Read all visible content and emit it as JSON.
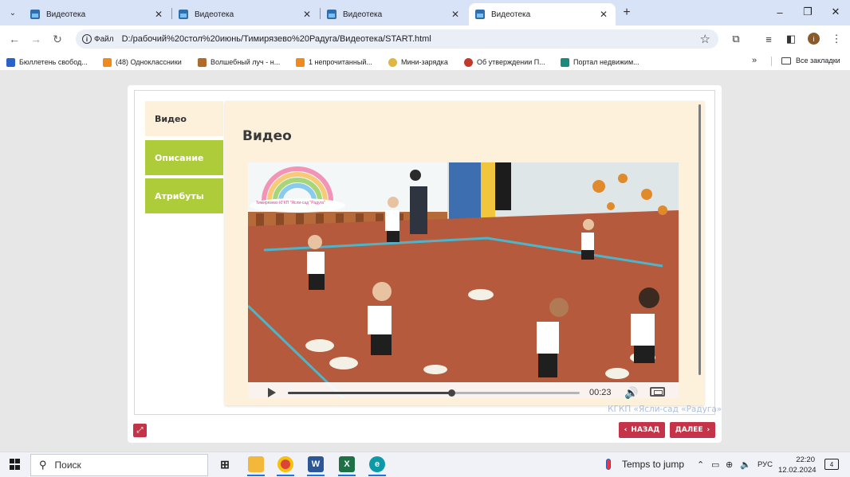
{
  "browser": {
    "tabs": [
      {
        "title": "Видеотека",
        "active": false
      },
      {
        "title": "Видеотека",
        "active": false
      },
      {
        "title": "Видеотека",
        "active": false
      },
      {
        "title": "Видеотека",
        "active": true
      }
    ],
    "new_tab": "+",
    "window_controls": {
      "minimize": "–",
      "restore": "❐",
      "close": "✕"
    },
    "address": {
      "scheme_label": "Файл",
      "url": "D:/рабочий%20стол%20июнь/Тимирязево%20Радуга/Видеотека/START.html"
    },
    "profile_initial": "i",
    "bookmarks": [
      {
        "label": "Бюллетень свобод...",
        "color": "#2a62c9"
      },
      {
        "label": "(48) Одноклассники",
        "color": "#f08a1c"
      },
      {
        "label": "Волшебный луч - н...",
        "color": "#b06a2a"
      },
      {
        "label": "1 непрочитанный...",
        "color": "#f08a1c"
      },
      {
        "label": "Мини-зарядка",
        "color": "#e0b640"
      },
      {
        "label": "Об утверждении П...",
        "color": "#c0392b"
      },
      {
        "label": "Портал недвижим...",
        "color": "#1a8a7c"
      }
    ],
    "bookmarks_more": "»",
    "all_bookmarks": "Все закладки"
  },
  "app": {
    "nav": [
      {
        "label": "Видео",
        "active": true
      },
      {
        "label": "Описание",
        "active": false
      },
      {
        "label": "Атрибуты",
        "active": false
      }
    ],
    "content_title": "Видео",
    "watermark": "Тимирязево КГКП \"Ясли-сад \"Радуга\"",
    "video": {
      "time": "00:23",
      "progress": 0.56
    },
    "org_name": "КГКП «Ясли-сад «Радуга»",
    "back_label": "НАЗАД",
    "next_label": "ДАЛЕЕ",
    "colors": {
      "accent": "#c53348",
      "tab_green": "#aecb3a",
      "panel": "#fdf1dc"
    }
  },
  "taskbar": {
    "search_placeholder": "Поиск",
    "weather": "Temps to jump",
    "lang": "РУС",
    "time": "22:20",
    "date": "12.02.2024",
    "notifications": "4"
  }
}
